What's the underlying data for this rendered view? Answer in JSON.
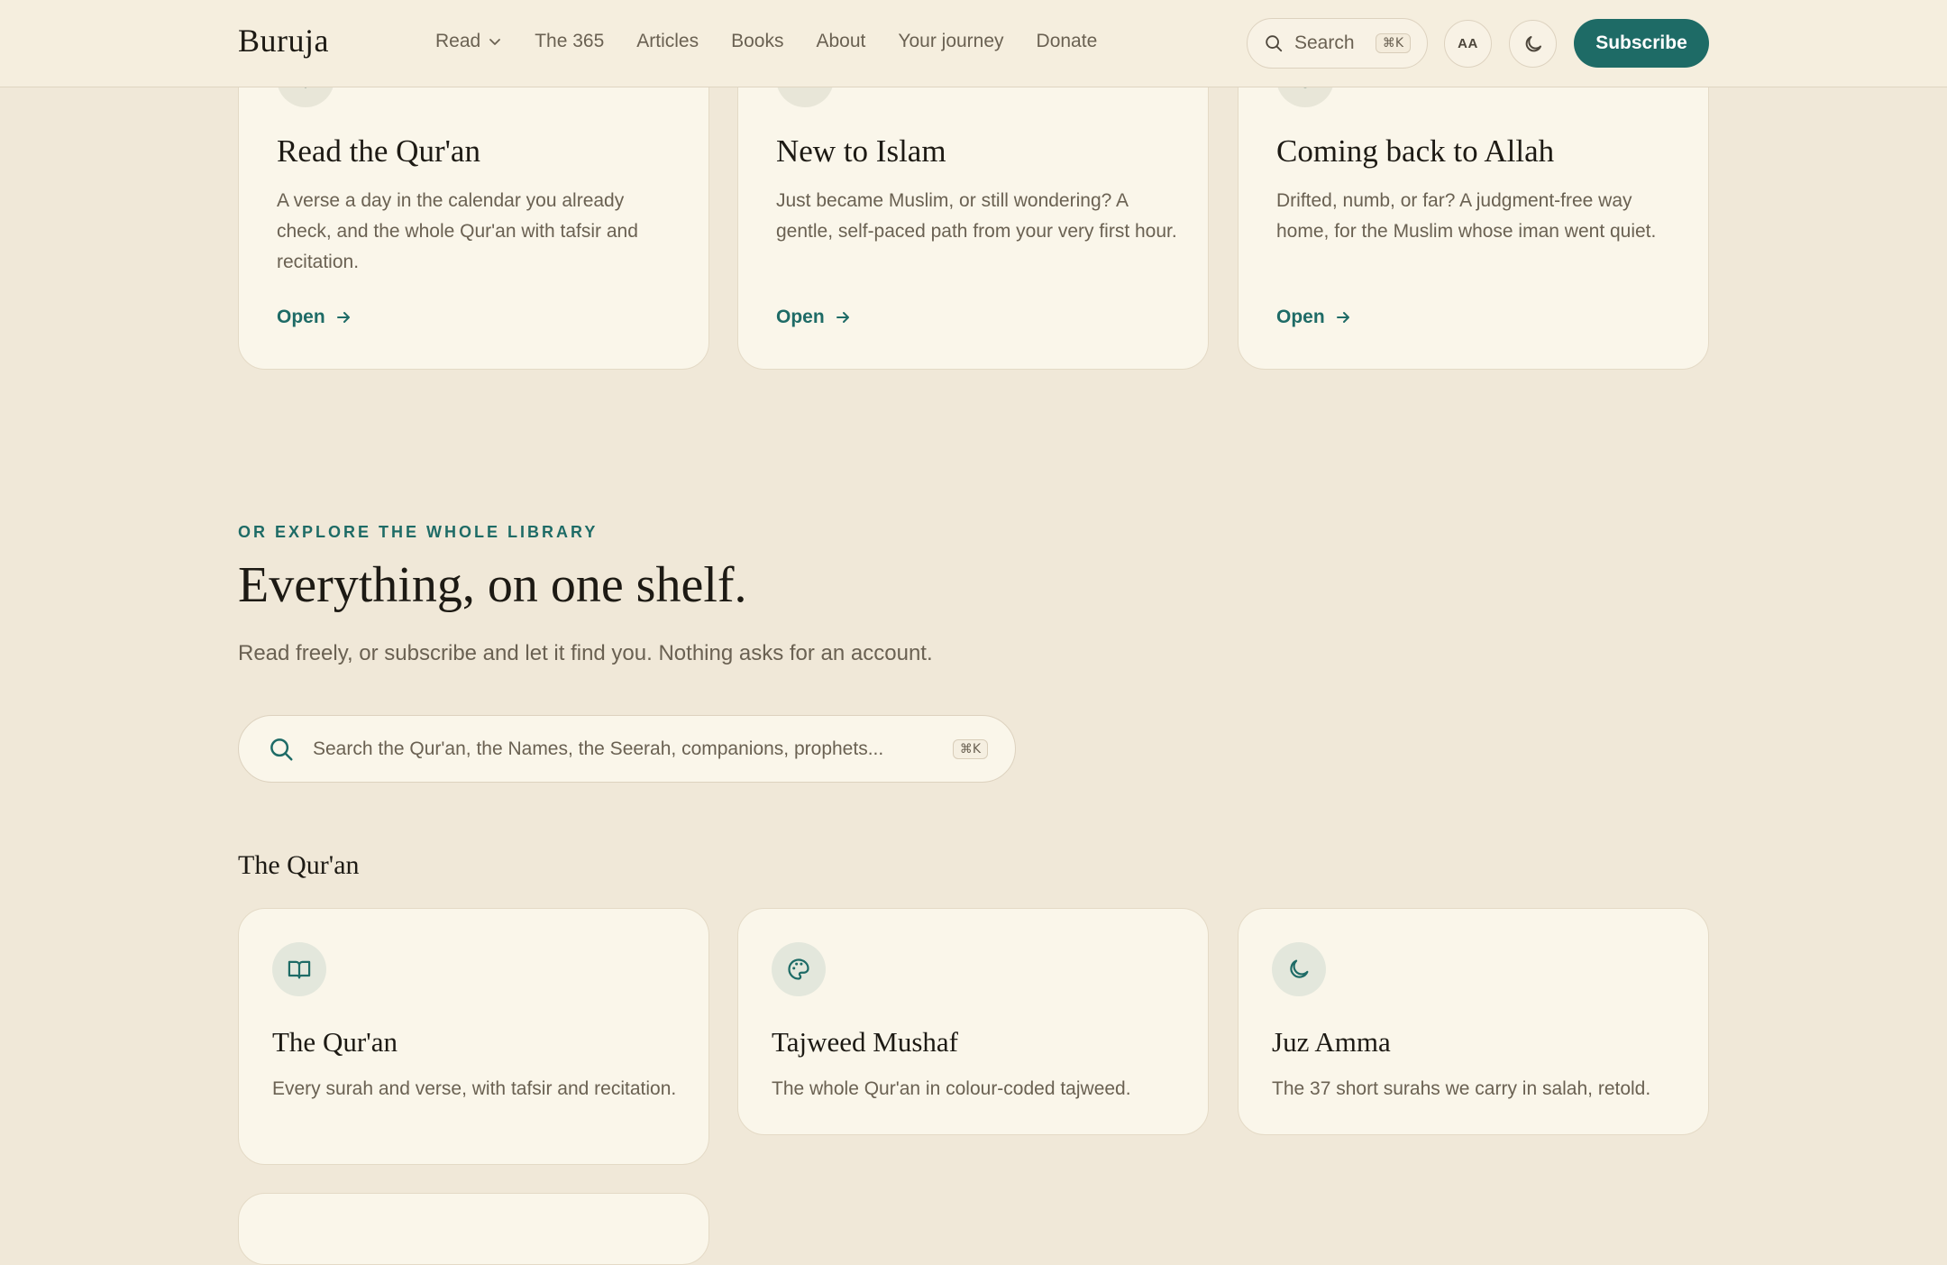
{
  "header": {
    "logo": "Buruja",
    "nav": [
      {
        "label": "Read",
        "has_dropdown": true
      },
      {
        "label": "The 365"
      },
      {
        "label": "Articles"
      },
      {
        "label": "Books"
      },
      {
        "label": "About"
      },
      {
        "label": "Your journey"
      },
      {
        "label": "Donate"
      }
    ],
    "search_label": "Search",
    "search_shortcut": "⌘K",
    "text_size_label": "AA",
    "theme_toggle_icon": "moon-icon",
    "subscribe_label": "Subscribe"
  },
  "paths": [
    {
      "title": "Read the Qur'an",
      "desc": "A verse a day in the calendar you already check, and the whole Qur'an with tafsir and recitation.",
      "link": "Open",
      "icon": "book-icon"
    },
    {
      "title": "New to Islam",
      "desc": "Just became Muslim, or still wondering? A gentle, self-paced path from your very first hour.",
      "link": "Open",
      "icon": "sprout-icon"
    },
    {
      "title": "Coming back to Allah",
      "desc": "Drifted, numb, or far? A judgment-free way home, for the Muslim whose iman went quiet.",
      "link": "Open",
      "icon": "heart-icon"
    }
  ],
  "library": {
    "eyebrow": "OR EXPLORE THE WHOLE LIBRARY",
    "title": "Everything, on one shelf.",
    "subtitle": "Read freely, or subscribe and let it find you. Nothing asks for an account.",
    "search_placeholder": "Search the Qur'an, the Names, the Seerah, companions, prophets...",
    "search_shortcut": "⌘K",
    "section_title": "The Qur'an",
    "items": [
      {
        "title": "The Qur'an",
        "desc": "Every surah and verse, with tafsir and recitation.",
        "icon": "book-open-icon"
      },
      {
        "title": "Tajweed Mushaf",
        "desc": "The whole Qur'an in colour-coded tajweed.",
        "icon": "palette-icon"
      },
      {
        "title": "Juz Amma",
        "desc": "The 37 short surahs we carry in salah, retold.",
        "icon": "moon-icon"
      }
    ]
  },
  "colors": {
    "accent": "#1e6b66",
    "background": "#f0e8d8",
    "card": "#faf6ea"
  }
}
